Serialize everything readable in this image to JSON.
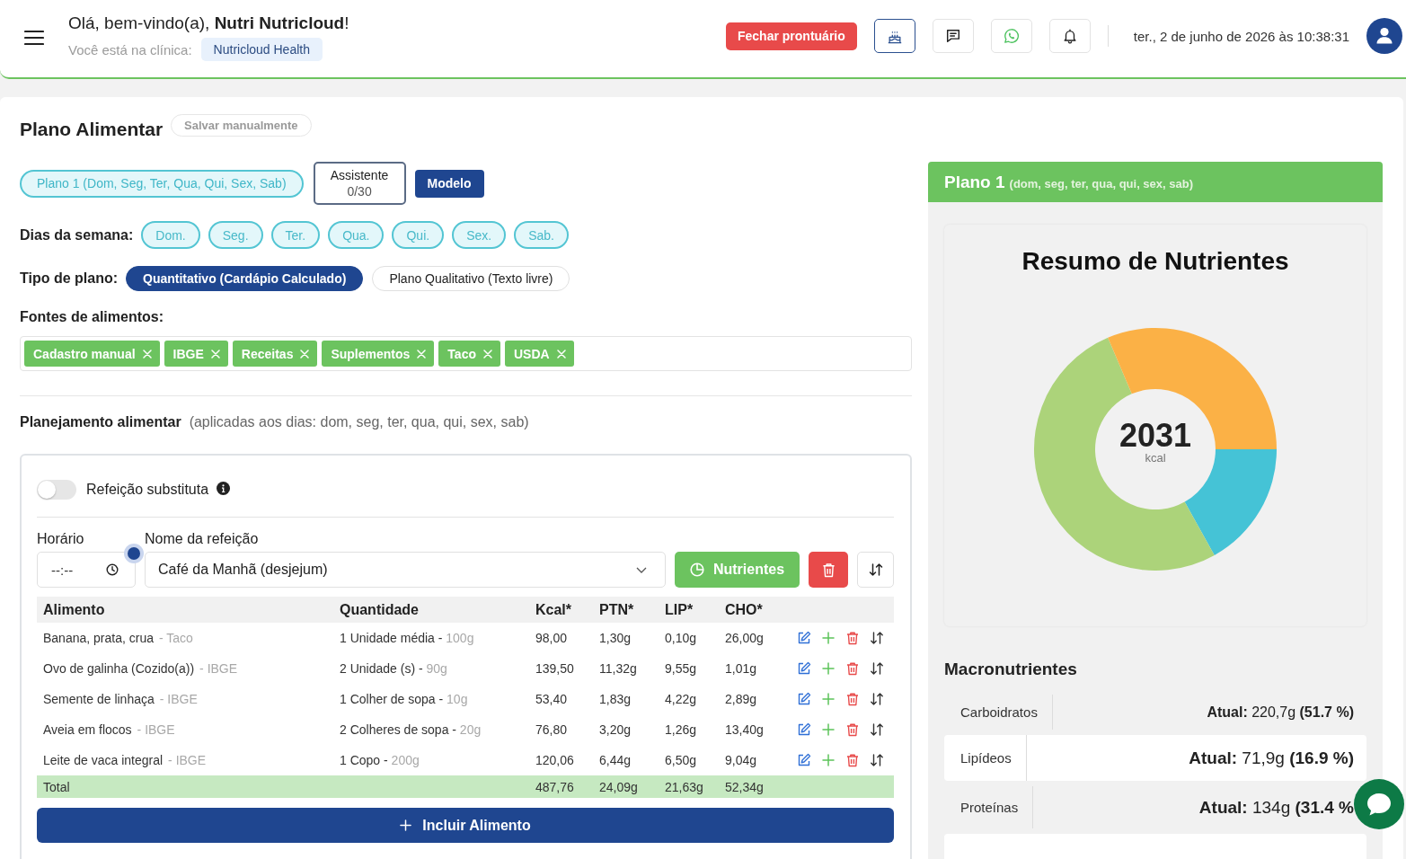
{
  "header": {
    "greeting": "Olá, bem-vindo(a), **Nutri Nutricloud**!",
    "clinic_label": "Você está na clínica:",
    "clinic": "Nutricloud Health",
    "close_button": "Fechar prontuário",
    "icon_buttons": [
      {
        "kind": "cake",
        "highlighted": true
      },
      {
        "kind": "message",
        "highlighted": false
      },
      {
        "kind": "phone-bubble",
        "highlighted": false
      },
      {
        "kind": "bell",
        "highlighted": false
      }
    ],
    "datetime": "ter., 2 de junho de 2026 às 10:38:31"
  },
  "plan": {
    "title": "Plano Alimentar",
    "save_button": "Salvar manualmente",
    "plan_tabs": [
      {
        "label": "Plano 1 (Dom, Seg, Ter, Qua, Qui, Sex, Sab)",
        "selected": true
      }
    ],
    "assistant": {
      "label": "Assistente",
      "count": "0/30"
    },
    "model_button": "Modelo",
    "weekdays_label": "Dias da semana:",
    "weekdays": [
      {
        "label": "Dom.",
        "selected": true
      },
      {
        "label": "Seg.",
        "selected": true
      },
      {
        "label": "Ter.",
        "selected": true
      },
      {
        "label": "Qua.",
        "selected": true
      },
      {
        "label": "Qui.",
        "selected": true
      },
      {
        "label": "Sex.",
        "selected": true
      },
      {
        "label": "Sab.",
        "selected": true
      }
    ],
    "plan_type_label": "Tipo de plano:",
    "plan_types": [
      {
        "label": "Quantitativo (Cardápio Calculado)",
        "selected": true
      },
      {
        "label": "Plano Qualitativo (Texto livre)",
        "selected": false
      }
    ],
    "sources_label": "Fontes de alimentos:",
    "sources": [
      "Cadastro manual",
      "IBGE",
      "Receitas",
      "Suplementos",
      "Taco",
      "USDA"
    ],
    "planning_title": "Planejamento alimentar",
    "planning_note": "(aplicadas aos dias: dom, seg, ter, qua, qui, sex, sab)"
  },
  "meal": {
    "substitute_toggle": {
      "label": "Refeição substituta",
      "on": false
    },
    "time_label": "Horário",
    "time_field": {
      "placeholder": "--:--"
    },
    "name_label": "Nome da refeição",
    "name_value": "Café da Manhã (desjejum)",
    "nutrients_button": "Nutrientes",
    "table": {
      "columns": [
        "Alimento",
        "Quantidade",
        "Kcal*",
        "PTN*",
        "LIP*",
        "CHO*"
      ],
      "rows": [
        {
          "food": "Banana, prata, crua",
          "source": "- Taco",
          "quantity": "1 Unidade média - 100g",
          "kcal": "98,00",
          "ptn": "1,30g",
          "lip": "0,10g",
          "cho": "26,00g"
        },
        {
          "food": "Ovo de galinha (Cozido(a))",
          "source": "- IBGE",
          "quantity": "2 Unidade (s) - 90g",
          "kcal": "139,50",
          "ptn": "11,32g",
          "lip": "9,55g",
          "cho": "1,01g"
        },
        {
          "food": "Semente de linhaça",
          "source": "- IBGE",
          "quantity": "1 Colher de sopa - 10g",
          "kcal": "53,40",
          "ptn": "1,83g",
          "lip": "4,22g",
          "cho": "2,89g"
        },
        {
          "food": "Aveia em flocos",
          "source": "- IBGE",
          "quantity": "2 Colheres de sopa - 20g",
          "kcal": "76,80",
          "ptn": "3,20g",
          "lip": "1,26g",
          "cho": "13,40g"
        },
        {
          "food": "Leite de vaca integral",
          "source": "- IBGE",
          "quantity": "1 Copo - 200g",
          "kcal": "120,06",
          "ptn": "6,44g",
          "lip": "6,50g",
          "cho": "9,04g"
        }
      ],
      "total": {
        "label": "Total",
        "kcal": "487,76",
        "ptn": "24,09g",
        "lip": "21,63g",
        "cho": "52,34g"
      }
    },
    "add_button": "Incluir Alimento"
  },
  "summary": {
    "plan_name": "Plano 1",
    "plan_days": "(dom, seg, ter, qua, qui, sex, sab)",
    "title": "Resumo de Nutrientes",
    "chart_data": {
      "type": "donut",
      "values": [
        16.9,
        51.7,
        31.4
      ],
      "colors": [
        "#45c3d6",
        "#acd37a",
        "#fbb146"
      ]
    },
    "total_value": "2031",
    "total_unit": "kcal",
    "macros_title": "Macronutrientes",
    "macros": [
      {
        "name": "Carboidratos",
        "reading": "**Atual:** 220,7g **(51.7 %)**"
      },
      {
        "name": "Lipídeos",
        "reading": "**Atual:** 71,9g **(16.9 %)**"
      },
      {
        "name": "Proteínas",
        "reading": "**Atual:** 134g **(31.4 %**"
      }
    ]
  }
}
